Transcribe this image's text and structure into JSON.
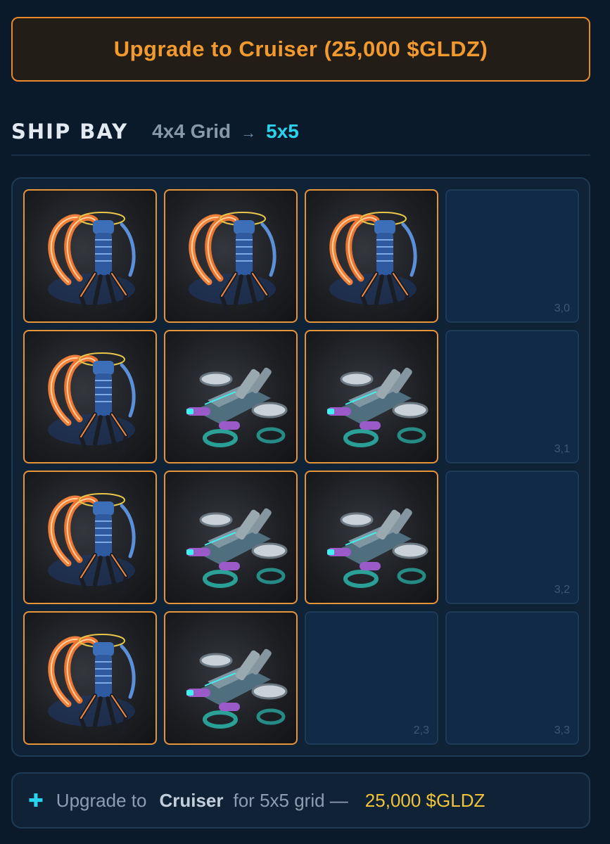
{
  "upgrade_button": {
    "label": "Upgrade to Cruiser (25,000 $GLDZ)"
  },
  "ship_bay": {
    "title": "SHIP BAY",
    "current_grid": "4x4 Grid",
    "arrow": "→",
    "next_grid": "5x5"
  },
  "slots": [
    {
      "occupant": "spider-drone"
    },
    {
      "occupant": "spider-drone"
    },
    {
      "occupant": "spider-drone"
    },
    {
      "occupant": null,
      "coord": "3,0"
    },
    {
      "occupant": "spider-drone"
    },
    {
      "occupant": "hover-ship"
    },
    {
      "occupant": "hover-ship"
    },
    {
      "occupant": null,
      "coord": "3,1"
    },
    {
      "occupant": "spider-drone"
    },
    {
      "occupant": "hover-ship"
    },
    {
      "occupant": "hover-ship"
    },
    {
      "occupant": null,
      "coord": "3,2"
    },
    {
      "occupant": "spider-drone"
    },
    {
      "occupant": "hover-ship"
    },
    {
      "occupant": null,
      "coord": "2,3"
    },
    {
      "occupant": null,
      "coord": "3,3"
    }
  ],
  "footer": {
    "icon": "plus-icon",
    "prefix": "Upgrade to",
    "ship_class": "Cruiser",
    "suffix": "for 5x5 grid —",
    "price": "25,000 $GLDZ"
  },
  "colors": {
    "accent_orange": "#e8892a",
    "accent_cyan": "#29d3ec",
    "price_gold": "#f0c43a",
    "background": "#0b1a2b"
  }
}
